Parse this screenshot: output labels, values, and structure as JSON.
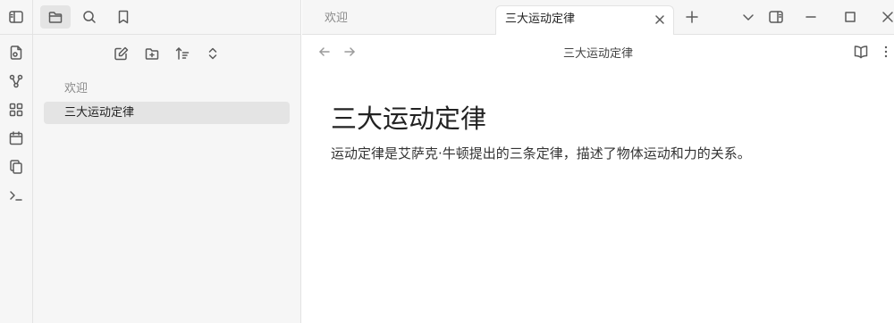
{
  "tabs": {
    "inactive_label": "欢迎",
    "active_label": "三大运动定律"
  },
  "file_tree": {
    "items": [
      {
        "label": "欢迎",
        "active": false
      },
      {
        "label": "三大运动定律",
        "active": true
      }
    ]
  },
  "view_header": {
    "title": "三大运动定律"
  },
  "document": {
    "title": "三大运动定律",
    "body": "运动定律是艾萨克·牛顿提出的三条定律，描述了物体运动和力的关系。"
  },
  "ribbon": {
    "icons": [
      "new-file-icon",
      "graph-view-icon",
      "canvas-icon",
      "daily-note-icon",
      "templates-icon",
      "command-palette-icon"
    ]
  },
  "sidebar_tabs": [
    "files-icon",
    "search-icon",
    "bookmark-icon"
  ],
  "nav_actions": [
    "new-note-icon",
    "new-folder-icon",
    "sort-icon",
    "collapse-icon"
  ],
  "colors": {
    "sidebar_bg": "#f6f6f6",
    "active_item_bg": "#e4e4e4",
    "border": "#e3e3e3"
  }
}
